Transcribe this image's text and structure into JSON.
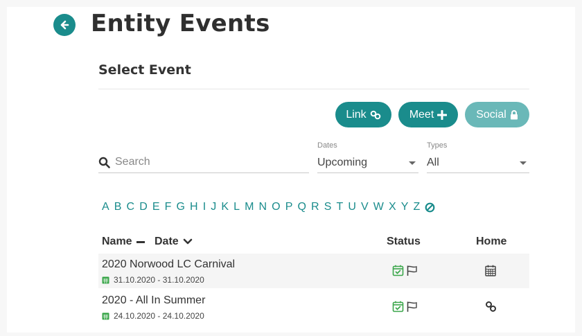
{
  "header": {
    "title": "Entity Events"
  },
  "section": {
    "title": "Select Event"
  },
  "actions": [
    {
      "label": "Link",
      "icon": "link-icon"
    },
    {
      "label": "Meet",
      "icon": "plus-icon"
    },
    {
      "label": "Social",
      "icon": "lock-icon"
    }
  ],
  "search": {
    "placeholder": "Search",
    "value": ""
  },
  "filters": {
    "dates": {
      "label": "Dates",
      "value": "Upcoming"
    },
    "types": {
      "label": "Types",
      "value": "All"
    }
  },
  "alphabet": [
    "A",
    "B",
    "C",
    "D",
    "E",
    "F",
    "G",
    "H",
    "I",
    "J",
    "K",
    "L",
    "M",
    "N",
    "O",
    "P",
    "Q",
    "R",
    "S",
    "T",
    "U",
    "V",
    "W",
    "X",
    "Y",
    "Z"
  ],
  "table": {
    "col_name": "Name",
    "col_date": "Date",
    "col_status": "Status",
    "col_home": "Home",
    "rows": [
      {
        "name": "2020 Norwood LC Carnival",
        "dates": "31.10.2020 - 31.10.2020",
        "home_icon": "calendar-icon"
      },
      {
        "name": "2020 - All In Summer",
        "dates": "24.10.2020 - 24.10.2020",
        "home_icon": "link-icon"
      }
    ]
  },
  "colors": {
    "accent": "#1a8c8c",
    "accent_disabled": "#6ab8b8",
    "status_green": "#3aa64a"
  }
}
